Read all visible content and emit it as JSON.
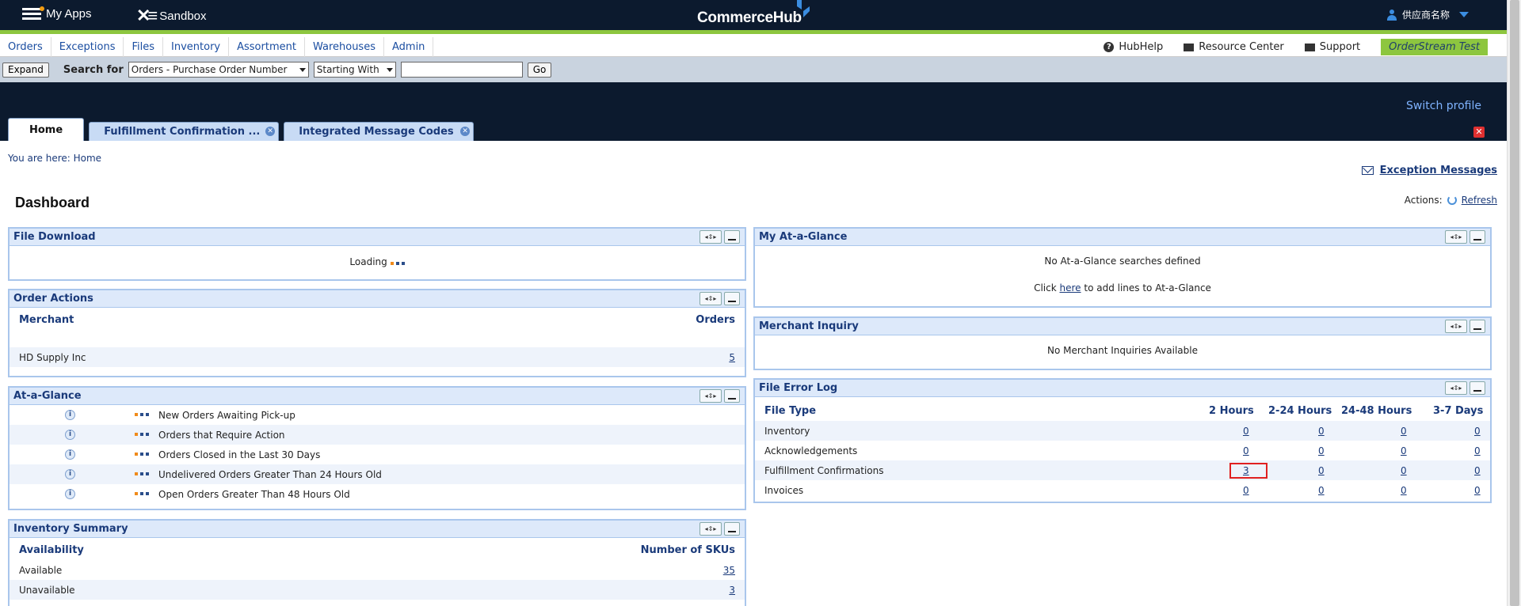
{
  "topbar": {
    "myapps": "My Apps",
    "sandbox": "Sandbox",
    "brand": "CommerceHub",
    "user": "供应商名称"
  },
  "menu": [
    "Orders",
    "Exceptions",
    "Files",
    "Inventory",
    "Assortment",
    "Warehouses",
    "Admin"
  ],
  "help": {
    "hubhelp": "HubHelp",
    "resource": "Resource Center",
    "support": "Support",
    "badge": "OrderStream Test"
  },
  "search": {
    "expand": "Expand",
    "label": "Search for",
    "field": "Orders - Purchase Order Number",
    "mode": "Starting With",
    "value": "",
    "go": "Go"
  },
  "header": {
    "switch_profile": "Switch profile",
    "tabs": [
      "Home",
      "Fulfillment Confirmation ...",
      "Integrated Message Codes"
    ]
  },
  "breadcrumb": "You are here: Home",
  "exception_messages": "Exception Messages",
  "dashboard_title": "Dashboard",
  "actions": {
    "label": "Actions:",
    "refresh": "Refresh"
  },
  "file_download": {
    "title": "File Download",
    "loading": "Loading"
  },
  "order_actions": {
    "title": "Order Actions",
    "col_merchant": "Merchant",
    "col_orders": "Orders",
    "rows": [
      {
        "merchant": "HD Supply Inc",
        "orders": "5"
      }
    ]
  },
  "at_a_glance": {
    "title": "At-a-Glance",
    "items": [
      "New Orders Awaiting Pick-up",
      "Orders that Require Action",
      "Orders Closed in the Last 30 Days",
      "Undelivered Orders Greater Than 24 Hours Old",
      "Open Orders Greater Than 48 Hours Old"
    ]
  },
  "inventory_summary": {
    "title": "Inventory Summary",
    "col_availability": "Availability",
    "col_skus": "Number of SKUs",
    "rows": [
      {
        "label": "Available",
        "count": "35"
      },
      {
        "label": "Unavailable",
        "count": "3"
      }
    ]
  },
  "my_at_a_glance": {
    "title": "My At-a-Glance",
    "empty": "No At-a-Glance searches defined",
    "click": "Click",
    "here": "here",
    "rest": "to add lines to At-a-Glance"
  },
  "merchant_inquiry": {
    "title": "Merchant Inquiry",
    "empty": "No Merchant Inquiries Available"
  },
  "file_error_log": {
    "title": "File Error Log",
    "headers": [
      "File Type",
      "2 Hours",
      "2-24 Hours",
      "24-48 Hours",
      "3-7 Days"
    ],
    "rows": [
      {
        "type": "Inventory",
        "values": [
          "0",
          "0",
          "0",
          "0"
        ]
      },
      {
        "type": "Acknowledgements",
        "values": [
          "0",
          "0",
          "0",
          "0"
        ]
      },
      {
        "type": "Fulfillment Confirmations",
        "values": [
          "3",
          "0",
          "0",
          "0"
        ]
      },
      {
        "type": "Invoices",
        "values": [
          "0",
          "0",
          "0",
          "0"
        ]
      }
    ]
  }
}
